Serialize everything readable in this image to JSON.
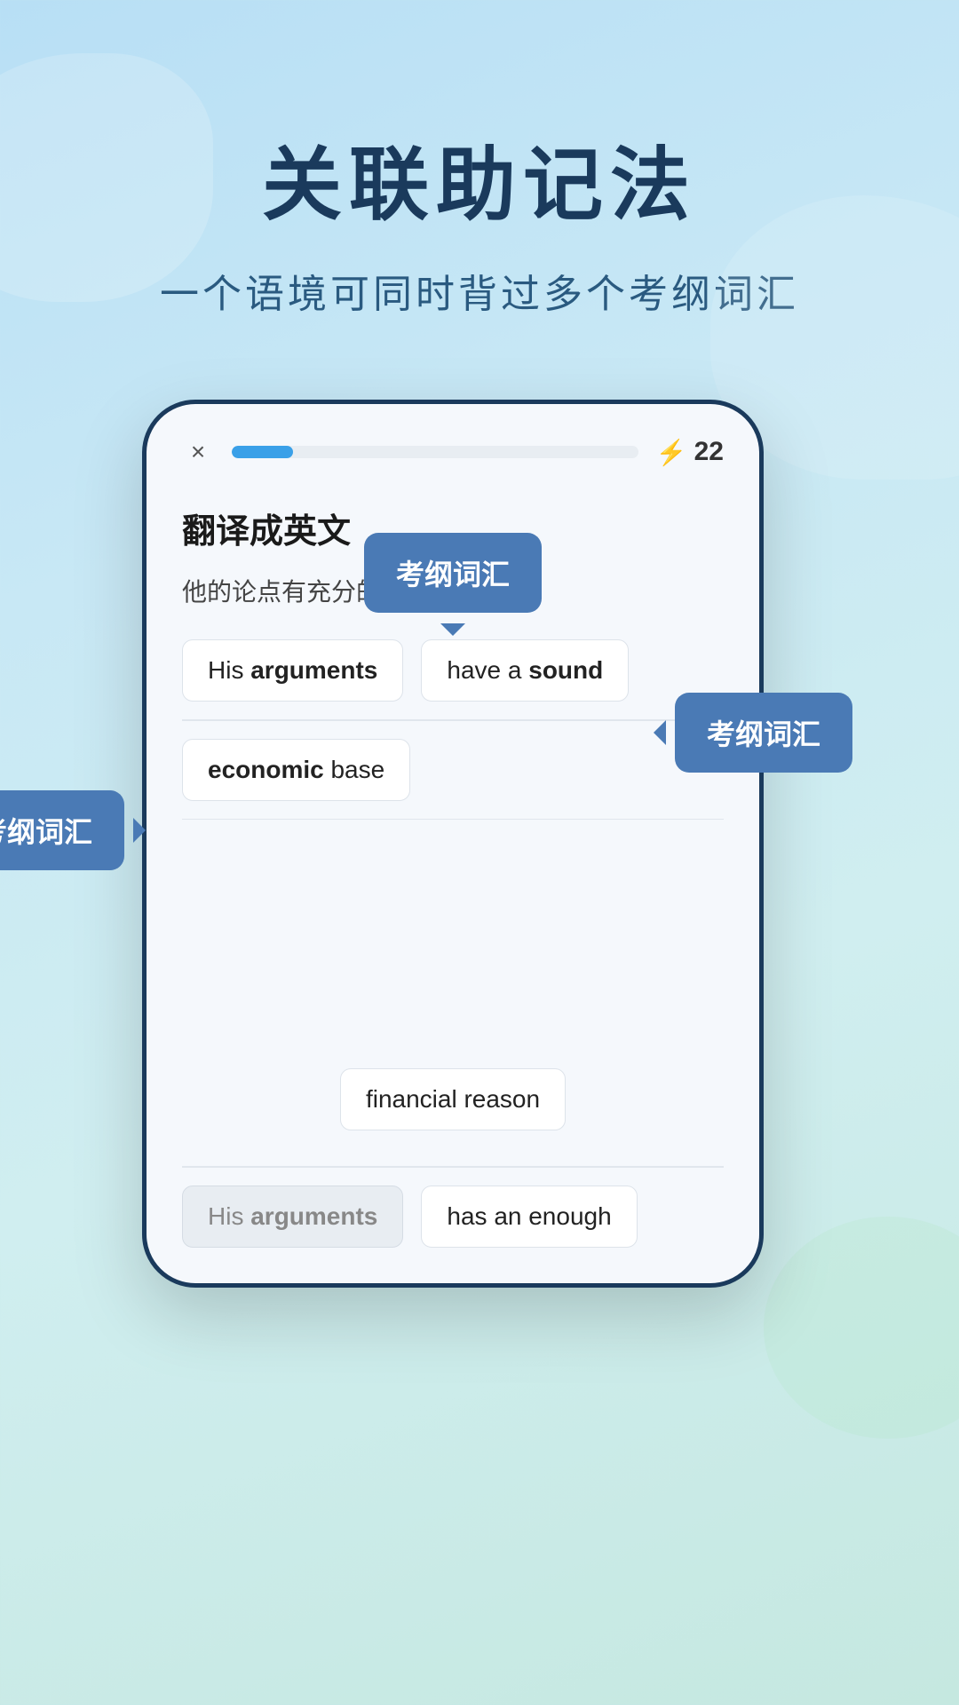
{
  "background": {
    "gradient_start": "#b8dff5",
    "gradient_end": "#c5e8e0"
  },
  "header": {
    "title": "关联助记法",
    "subtitle": "一个语境可同时背过多个考纲词汇"
  },
  "phone": {
    "progress_percent": 15,
    "score": 22,
    "close_label": "×",
    "lightning_symbol": "⚡",
    "translate_label": "翻译成英文",
    "chinese_sentence": "他的论点有充分的经济上的根据",
    "answer_row1_part1": "His ",
    "answer_row1_bold1": "arguments",
    "answer_row1_part2": "have a ",
    "answer_row1_bold2": "sound",
    "answer_row2_part1": "economic",
    "answer_row2_part2": " base",
    "bottom_chip_text": "financial reason",
    "bottom_chip_bold": "",
    "bottom_row_chip1_part1": "His ",
    "bottom_row_chip1_bold": "arguments",
    "bottom_row_chip2_text": "has an enough"
  },
  "tooltips": [
    {
      "id": "tooltip-1",
      "label": "考纲词汇"
    },
    {
      "id": "tooltip-2",
      "label": "考纲词汇"
    },
    {
      "id": "tooltip-3",
      "label": "考纲词汇"
    }
  ]
}
